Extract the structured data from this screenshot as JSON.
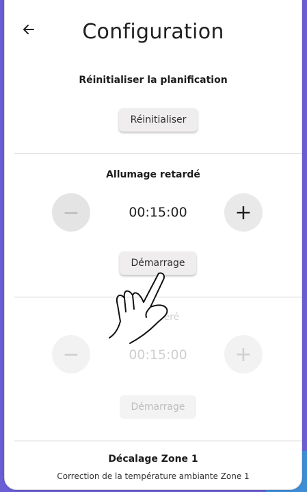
{
  "header": {
    "title": "Configuration",
    "back_icon": "arrow-left-icon"
  },
  "reset_section": {
    "title": "Réinitialiser la planification",
    "button": "Réinitialiser"
  },
  "delayed_start": {
    "title": "Allumage retardé",
    "time": "00:15:00",
    "minus": "−",
    "plus": "+",
    "button": "Démarrage"
  },
  "delayed_second": {
    "title": "…fféré",
    "time": "00:15:00",
    "minus": "−",
    "plus": "+",
    "button": "Démarrage"
  },
  "offset_section": {
    "title": "Décalage Zone 1",
    "subtitle": "Correction de la température ambiante Zone 1"
  },
  "colors": {
    "accent": "#6b5fd6",
    "text": "#202020",
    "disabled": "#cfcfcf"
  }
}
